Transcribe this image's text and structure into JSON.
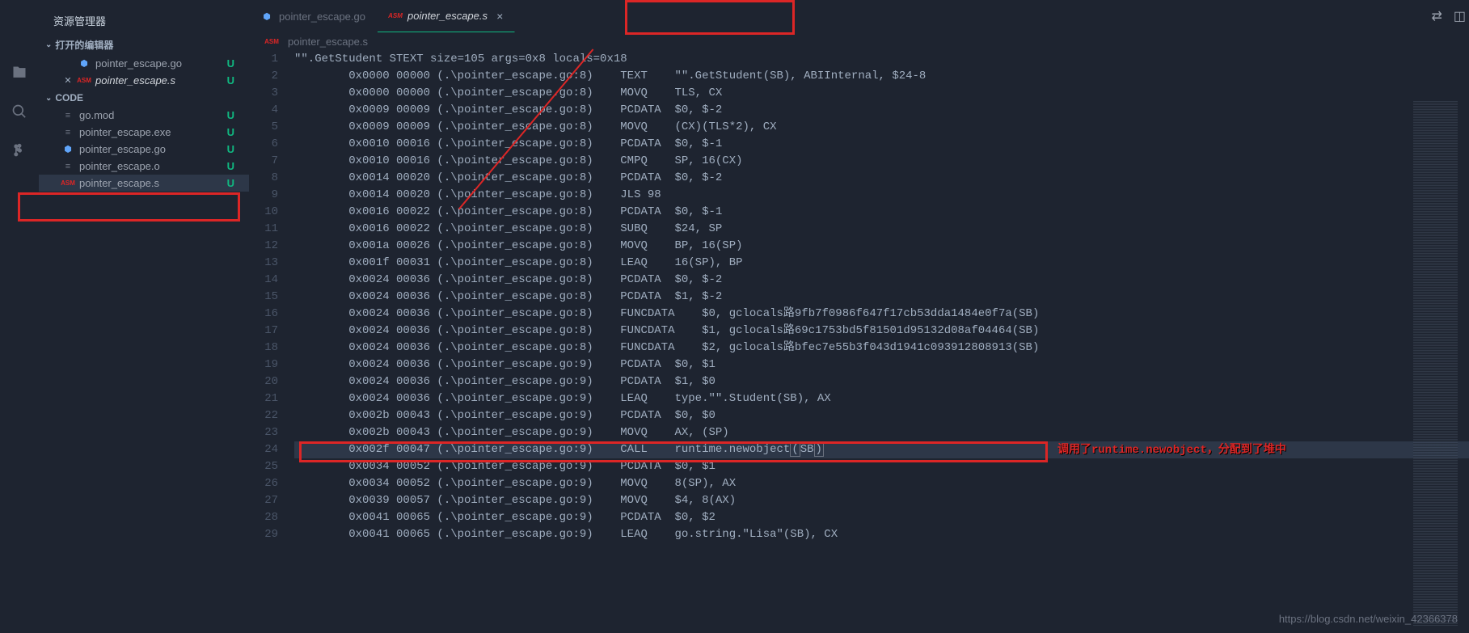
{
  "sidebar": {
    "title": "资源管理器",
    "sections": {
      "open_editors": "打开的编辑器",
      "code": "CODE"
    },
    "open_items": [
      {
        "icon": "go",
        "name": "pointer_escape.go",
        "status": "U"
      },
      {
        "icon": "asm",
        "name": "pointer_escape.s",
        "status": "U",
        "active": true,
        "close": true
      }
    ],
    "code_items": [
      {
        "icon": "lines",
        "name": "go.mod",
        "status": "U"
      },
      {
        "icon": "lines",
        "name": "pointer_escape.exe",
        "status": "U"
      },
      {
        "icon": "go",
        "name": "pointer_escape.go",
        "status": "U"
      },
      {
        "icon": "lines",
        "name": "pointer_escape.o",
        "status": "U"
      },
      {
        "icon": "asm",
        "name": "pointer_escape.s",
        "status": "U",
        "selected": true
      }
    ]
  },
  "tabs": [
    {
      "icon": "go",
      "name": "pointer_escape.go",
      "active": false
    },
    {
      "icon": "asm",
      "name": "pointer_escape.s",
      "active": true,
      "close": true
    }
  ],
  "breadcrumb": {
    "icon": "asm",
    "name": "pointer_escape.s"
  },
  "annotation_text": "调用了runtime.newobject，分配到了堆中",
  "watermark": "https://blog.csdn.net/weixin_42366378",
  "code": [
    "\"\".GetStudent STEXT size=105 args=0x8 locals=0x18",
    "        0x0000 00000 (.\\pointer_escape.go:8)    TEXT    \"\".GetStudent(SB), ABIInternal, $24-8",
    "        0x0000 00000 (.\\pointer_escape.go:8)    MOVQ    TLS, CX",
    "        0x0009 00009 (.\\pointer_escape.go:8)    PCDATA  $0, $-2",
    "        0x0009 00009 (.\\pointer_escape.go:8)    MOVQ    (CX)(TLS*2), CX",
    "        0x0010 00016 (.\\pointer_escape.go:8)    PCDATA  $0, $-1",
    "        0x0010 00016 (.\\pointer_escape.go:8)    CMPQ    SP, 16(CX)",
    "        0x0014 00020 (.\\pointer_escape.go:8)    PCDATA  $0, $-2",
    "        0x0014 00020 (.\\pointer_escape.go:8)    JLS 98",
    "        0x0016 00022 (.\\pointer_escape.go:8)    PCDATA  $0, $-1",
    "        0x0016 00022 (.\\pointer_escape.go:8)    SUBQ    $24, SP",
    "        0x001a 00026 (.\\pointer_escape.go:8)    MOVQ    BP, 16(SP)",
    "        0x001f 00031 (.\\pointer_escape.go:8)    LEAQ    16(SP), BP",
    "        0x0024 00036 (.\\pointer_escape.go:8)    PCDATA  $0, $-2",
    "        0x0024 00036 (.\\pointer_escape.go:8)    PCDATA  $1, $-2",
    "        0x0024 00036 (.\\pointer_escape.go:8)    FUNCDATA    $0, gclocals路9fb7f0986f647f17cb53dda1484e0f7a(SB)",
    "        0x0024 00036 (.\\pointer_escape.go:8)    FUNCDATA    $1, gclocals路69c1753bd5f81501d95132d08af04464(SB)",
    "        0x0024 00036 (.\\pointer_escape.go:8)    FUNCDATA    $2, gclocals路bfec7e55b3f043d1941c093912808913(SB)",
    "        0x0024 00036 (.\\pointer_escape.go:9)    PCDATA  $0, $1",
    "        0x0024 00036 (.\\pointer_escape.go:9)    PCDATA  $1, $0",
    "        0x0024 00036 (.\\pointer_escape.go:9)    LEAQ    type.\"\".Student(SB), AX",
    "        0x002b 00043 (.\\pointer_escape.go:9)    PCDATA  $0, $0",
    "        0x002b 00043 (.\\pointer_escape.go:9)    MOVQ    AX, (SP)",
    "        0x002f 00047 (.\\pointer_escape.go:9)    CALL    runtime.newobject(SB)",
    "        0x0034 00052 (.\\pointer_escape.go:9)    PCDATA  $0, $1",
    "        0x0034 00052 (.\\pointer_escape.go:9)    MOVQ    8(SP), AX",
    "        0x0039 00057 (.\\pointer_escape.go:9)    MOVQ    $4, 8(AX)",
    "        0x0041 00065 (.\\pointer_escape.go:9)    PCDATA  $0, $2",
    "        0x0041 00065 (.\\pointer_escape.go:9)    LEAQ    go.string.\"Lisa\"(SB), CX"
  ]
}
